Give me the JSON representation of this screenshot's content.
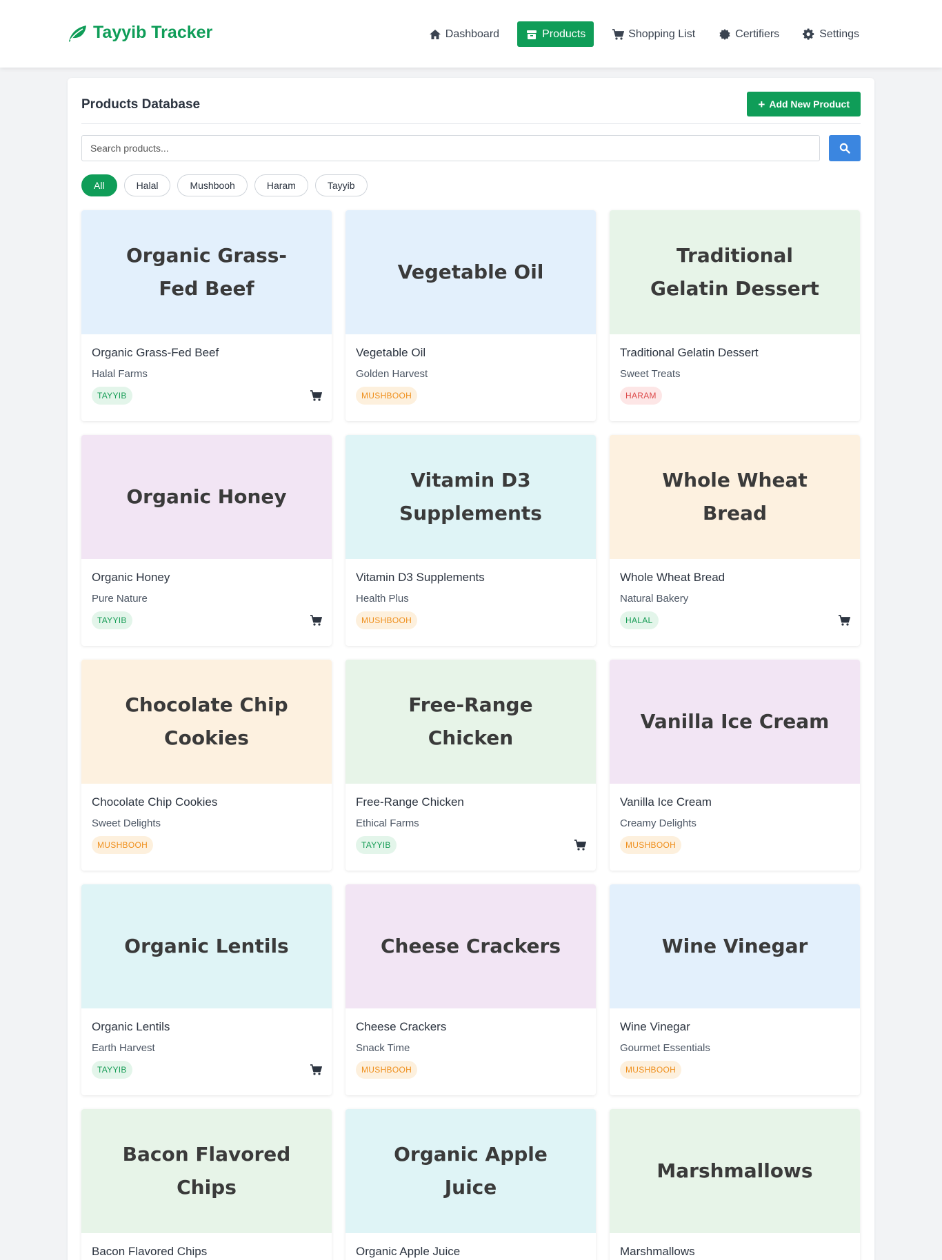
{
  "app": {
    "title": "Tayyib Tracker",
    "brand_color": "#0f9d58"
  },
  "nav": [
    {
      "label": "Dashboard",
      "icon": "home-icon",
      "active": false
    },
    {
      "label": "Products",
      "icon": "box-icon",
      "active": true
    },
    {
      "label": "Shopping List",
      "icon": "cart-icon",
      "active": false
    },
    {
      "label": "Certifiers",
      "icon": "certificate-icon",
      "active": false
    },
    {
      "label": "Settings",
      "icon": "gear-icon",
      "active": false
    }
  ],
  "page": {
    "title": "Products Database",
    "add_button": "Add New Product"
  },
  "search": {
    "placeholder": "Search products...",
    "value": ""
  },
  "filters": [
    {
      "label": "All",
      "active": true
    },
    {
      "label": "Halal",
      "active": false
    },
    {
      "label": "Mushbooh",
      "active": false
    },
    {
      "label": "Haram",
      "active": false
    },
    {
      "label": "Tayyib",
      "active": false
    }
  ],
  "products": [
    {
      "name": "Organic Grass-Fed Beef",
      "brand": "Halal Farms",
      "status": "TAYYIB",
      "cart": true,
      "bg": "#e3f0fc"
    },
    {
      "name": "Vegetable Oil",
      "brand": "Golden Harvest",
      "status": "MUSHBOOH",
      "cart": false,
      "bg": "#e3f0fc"
    },
    {
      "name": "Traditional Gelatin Dessert",
      "brand": "Sweet Treats",
      "status": "HARAM",
      "cart": false,
      "bg": "#e7f4e8"
    },
    {
      "name": "Organic Honey",
      "brand": "Pure Nature",
      "status": "TAYYIB",
      "cart": true,
      "bg": "#f2e5f4"
    },
    {
      "name": "Vitamin D3 Supplements",
      "brand": "Health Plus",
      "status": "MUSHBOOH",
      "cart": false,
      "bg": "#dff4f6"
    },
    {
      "name": "Whole Wheat Bread",
      "brand": "Natural Bakery",
      "status": "HALAL",
      "cart": true,
      "bg": "#fdf1e0"
    },
    {
      "name": "Chocolate Chip Cookies",
      "brand": "Sweet Delights",
      "status": "MUSHBOOH",
      "cart": false,
      "bg": "#fdf1e0"
    },
    {
      "name": "Free-Range Chicken",
      "brand": "Ethical Farms",
      "status": "TAYYIB",
      "cart": true,
      "bg": "#e7f4e8"
    },
    {
      "name": "Vanilla Ice Cream",
      "brand": "Creamy Delights",
      "status": "MUSHBOOH",
      "cart": false,
      "bg": "#f2e5f4"
    },
    {
      "name": "Organic Lentils",
      "brand": "Earth Harvest",
      "status": "TAYYIB",
      "cart": true,
      "bg": "#dff4f6"
    },
    {
      "name": "Cheese Crackers",
      "brand": "Snack Time",
      "status": "MUSHBOOH",
      "cart": false,
      "bg": "#f2e5f4"
    },
    {
      "name": "Wine Vinegar",
      "brand": "Gourmet Essentials",
      "status": "MUSHBOOH",
      "cart": false,
      "bg": "#e3f0fc"
    },
    {
      "name": "Bacon Flavored Chips",
      "brand": "",
      "status": "",
      "cart": false,
      "bg": "#e7f4e8"
    },
    {
      "name": "Organic Apple Juice",
      "brand": "",
      "status": "",
      "cart": false,
      "bg": "#dff4f6"
    },
    {
      "name": "Marshmallows",
      "brand": "",
      "status": "",
      "cart": false,
      "bg": "#e7f4e8"
    }
  ]
}
